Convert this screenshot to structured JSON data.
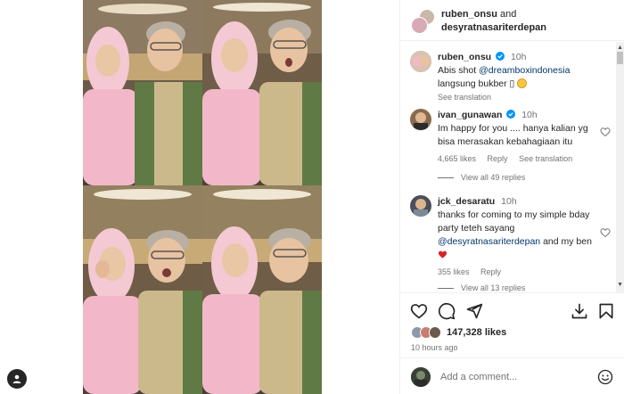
{
  "post": {
    "header": {
      "user1": "ruben_onsu",
      "and": "and",
      "user2": "desyratnasariterdepan"
    },
    "caption": {
      "user": "ruben_onsu",
      "time": "10h",
      "text_pre": "Abis shot ",
      "mention": "@dreamboxindonesia",
      "text_line2": "langsung bukber ▯ ",
      "see_translation": "See translation"
    },
    "comments": [
      {
        "user": "ivan_gunawan",
        "time": "10h",
        "text": "Im happy for you .... hanya kalian yg bisa merasakan kebahagiaan itu",
        "likes": "4,665 likes",
        "reply": "Reply",
        "see_translation": "See translation",
        "view_replies": "View all 49 replies"
      },
      {
        "user": "jck_desaratu",
        "time": "10h",
        "text_pre": "thanks for coming to my simple bday party teteh sayang ",
        "mention": "@desyratnasariterdepan",
        "text_post": " and my ben ",
        "likes": "355 likes",
        "reply": "Reply",
        "view_replies": "View all 13 replies"
      }
    ],
    "likes": "147,328 likes",
    "time_ago": "10 hours ago",
    "add_comment_placeholder": "Add a comment..."
  },
  "icons": {
    "like": "heart-icon",
    "comment": "comment-icon",
    "share": "send-icon",
    "download": "download-icon",
    "save": "bookmark-icon",
    "emoji": "smiley-icon",
    "tag": "user-tag-icon",
    "verified": "verified-badge-icon"
  },
  "colors": {
    "verified": "#0095f6",
    "mention": "#00376b",
    "heart_red": "#ed4956",
    "muted_text": "#737373"
  }
}
